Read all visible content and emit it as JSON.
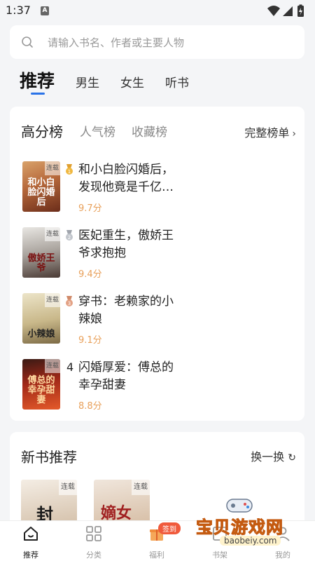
{
  "status_bar": {
    "time": "1:37",
    "notif_letter": "A"
  },
  "search": {
    "placeholder": "请输入书名、作者或主要人物"
  },
  "top_tabs": [
    "推荐",
    "男生",
    "女生",
    "听书"
  ],
  "ranking": {
    "tabs": [
      "高分榜",
      "人气榜",
      "收藏榜"
    ],
    "full_list_label": "完整榜单",
    "books": [
      {
        "rank": "1",
        "title": "和小白脸闪婚后，发现他竟是千亿…",
        "score": "9.7分",
        "cover_tag": "连载",
        "cover_title": "和小白脸闪婚后"
      },
      {
        "rank": "2",
        "title": "医妃重生，傲娇王爷求抱抱",
        "score": "9.4分",
        "cover_tag": "连载",
        "cover_title": "傲娇王爷"
      },
      {
        "rank": "3",
        "title": "穿书：老赖家的小辣娘",
        "score": "9.1分",
        "cover_tag": "连载",
        "cover_title": "小辣娘"
      },
      {
        "rank": "4",
        "title": "闪婚厚爱：傅总的幸孕甜妻",
        "score": "8.8分",
        "cover_tag": "连载",
        "cover_title": "傅总的幸孕甜妻"
      }
    ]
  },
  "new_books": {
    "title": "新书推荐",
    "swap_label": "换一换",
    "covers": [
      {
        "tag": "连载",
        "title": "封"
      },
      {
        "tag": "连载",
        "title": "嫡女"
      }
    ]
  },
  "bottom_nav": {
    "items": [
      "推荐",
      "分类",
      "福利",
      "书架",
      "我的"
    ],
    "sign_badge": "签到"
  },
  "watermark": {
    "text": "宝贝游戏网",
    "url": "baobeiy.com"
  },
  "colors": {
    "accent": "#2a73e8",
    "score": "#e8a05a",
    "badge": "#f05a3c"
  }
}
